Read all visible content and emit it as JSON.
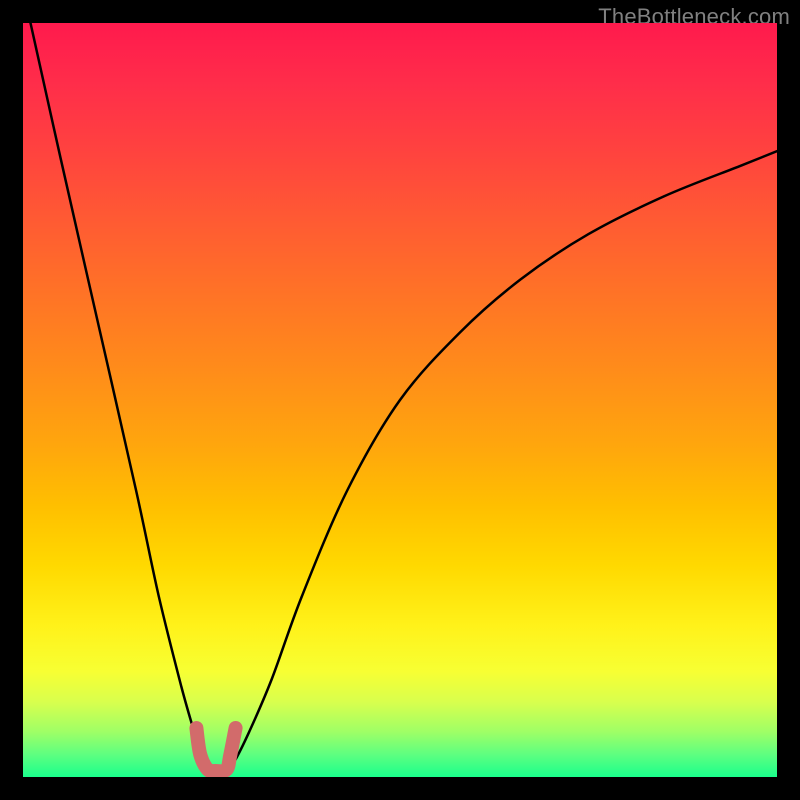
{
  "watermark": "TheBottleneck.com",
  "colors": {
    "background": "#000000",
    "curve_stroke": "#000000",
    "notch_stroke": "#d26b6b",
    "gradient_top": "#ff1a4d",
    "gradient_bottom": "#1aff8c",
    "watermark_text": "#808080"
  },
  "chart_data": {
    "type": "line",
    "title": "",
    "xlabel": "",
    "ylabel": "",
    "xlim": [
      0,
      100
    ],
    "ylim": [
      0,
      100
    ],
    "notes": "Two-branch bottleneck curve. Vertical axis represents bottleneck percentage (high=red, low=green). Horizontal axis represents a hardware balance ratio. Values are approximate, read from visual proportions of the plot; no axis ticks or numeric labels are rendered in the original image.",
    "series": [
      {
        "name": "left-branch",
        "x": [
          1,
          5,
          10,
          15,
          18,
          21,
          23,
          24,
          25
        ],
        "y": [
          100,
          82,
          60,
          38,
          24,
          12,
          5,
          2,
          1
        ]
      },
      {
        "name": "right-branch",
        "x": [
          27,
          28,
          30,
          33,
          37,
          43,
          50,
          58,
          66,
          75,
          85,
          95,
          100
        ],
        "y": [
          1,
          2,
          6,
          13,
          24,
          38,
          50,
          59,
          66,
          72,
          77,
          81,
          83
        ]
      },
      {
        "name": "notch",
        "x": [
          23.0,
          23.5,
          24.5,
          25.5,
          27.0,
          27.5,
          28.2
        ],
        "y": [
          6.5,
          3.0,
          1.0,
          0.8,
          1.0,
          3.0,
          6.5
        ]
      }
    ]
  }
}
